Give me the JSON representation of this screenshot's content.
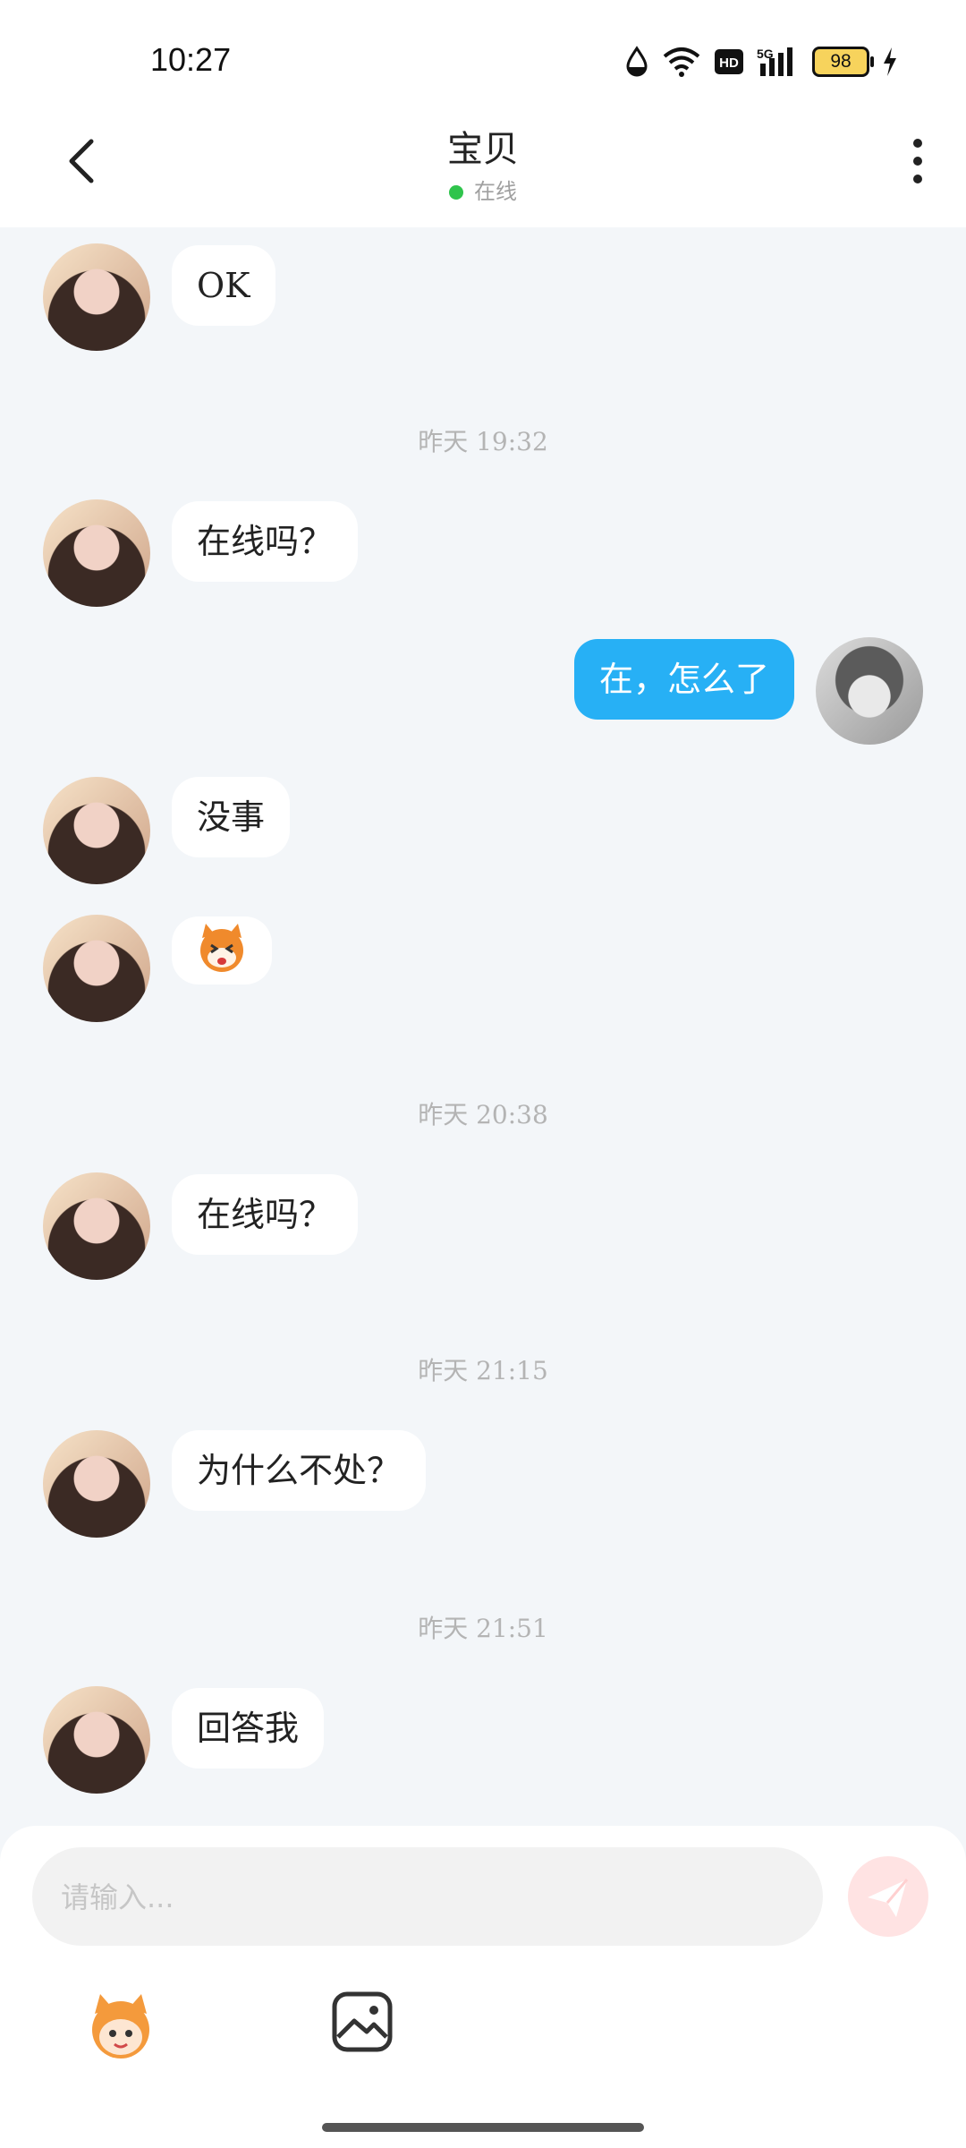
{
  "status_bar": {
    "time": "10:27",
    "battery": "98",
    "icons": [
      "water-drop-icon",
      "wifi-icon",
      "hd-icon",
      "signal-5g-icon",
      "battery-icon",
      "charging-icon"
    ]
  },
  "header": {
    "title": "宝贝",
    "status": "在线",
    "status_color": "#2fc44c",
    "back_icon": "chevron-left-icon",
    "more_icon": "more-vertical-icon"
  },
  "messages": [
    {
      "from": "her",
      "text": "OK"
    },
    {
      "type": "time",
      "text": "昨天 19:32"
    },
    {
      "from": "her",
      "text": "在线吗？"
    },
    {
      "from": "me",
      "text": "在，怎么了"
    },
    {
      "from": "her",
      "text": "没事"
    },
    {
      "from": "her",
      "sticker": "fox-sticker-icon"
    },
    {
      "type": "time",
      "text": "昨天 20:38"
    },
    {
      "from": "her",
      "text": "在线吗？"
    },
    {
      "type": "time",
      "text": "昨天 21:15"
    },
    {
      "from": "her",
      "text": "为什么不处？"
    },
    {
      "type": "time",
      "text": "昨天 21:51"
    },
    {
      "from": "her",
      "text": "回答我"
    }
  ],
  "composer": {
    "placeholder": "请输入...",
    "send_icon": "paper-plane-icon",
    "tools": [
      "mascot-emoji-icon",
      "image-icon"
    ]
  },
  "colors": {
    "my_bubble": "#27b0f5",
    "their_bubble": "#ffffff",
    "background": "#f3f6f9"
  }
}
